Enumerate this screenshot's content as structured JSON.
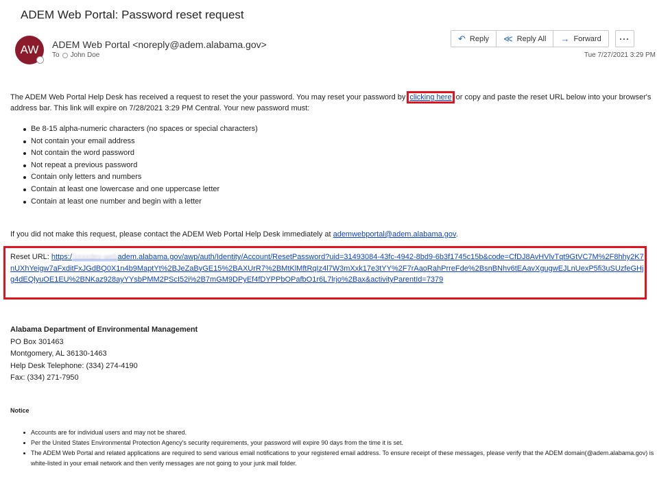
{
  "email": {
    "subject": "ADEM Web Portal: Password reset request",
    "avatar_initials": "AW",
    "sender": "ADEM Web Portal <noreply@adem.alabama.gov>",
    "to_label": "To",
    "recipient": "John Doe",
    "timestamp": "Tue 7/27/2021 3:29 PM"
  },
  "toolbar": {
    "reply_label": "Reply",
    "reply_all_label": "Reply All",
    "forward_label": "Forward",
    "more_label": "···",
    "reply_icon": "reply-arrow-icon",
    "reply_all_icon": "reply-all-arrow-icon",
    "forward_icon": "forward-arrow-icon"
  },
  "body": {
    "intro_before": "The ADEM Web Portal Help Desk has received a request to reset the your password. You may reset your password by ",
    "link_text": "clicking here",
    "intro_after": " or copy and paste the reset URL below into your browser's address bar. This link will expire on 7/28/2021 3:29 PM Central. Your new password must:",
    "requirements": [
      "Be 8-15 alpha-numeric characters (no spaces or special characters)",
      "Not contain your email address",
      "Not contain the word password",
      "Not repeat a previous password",
      "Contain only letters and numbers",
      "Contain at least one lowercase and one uppercase letter",
      "Contain at least one number and begin with a letter"
    ],
    "contact_text": "If you did not make this request, please contact the ADEM Web Portal Help Desk immediately at ",
    "contact_email": "ademwebportal@adem.alabama.gov",
    "contact_end": ".",
    "reset_label": "Reset URL: ",
    "reset_url_start": "https:/",
    "reset_url_blurred": "/xxxxdev-web",
    "reset_url_rest": "adem.alabama.gov/awp/auth/Identity/Account/ResetPassword?uid=31493084-43fc-4942-8bd9-6b3f1745c15b&code=CfDJ8AvHVlvTqt9GtVC7M%2F8hhy2K7nUXhYeigw7aFxditFxJGdBQ0X1n4b9MaptYt%2BJeZaByGE15%2BAXUrR7%2BMtKlMftRqIz4l7W3mXxk17e3tYY%2F7rAaoRahPrreFde%2BsnBNhv6tEAavXgugwEJLnUexP5fi3uSUzfeGHjg4dEQlyuOE1EU%2BNKaz928ayYYsbPMM2PScI52i%2B7mGM9DPyEf4fDYPPbOPafbO1r6L7lrjo%2Bax&activityParentId=7379"
  },
  "organization": {
    "name": "Alabama Department of Environmental Management",
    "po_box": "PO Box 301463",
    "city": "Montgomery, AL 36130-1463",
    "phone": "Help Desk Telephone: (334) 274-4190",
    "fax": "Fax: (334) 271-7950"
  },
  "notice": {
    "title": "Notice",
    "items": [
      "Accounts are for individual users and may not be shared.",
      "Per the United States Environmental Protection Agency's security requirements, your password will expire 90 days from the time it is set.",
      "The ADEM Web Portal and related applications are required to send various email notifications to your registered email address. To ensure receipt of these messages, please verify that the ADEM domain(@adem.alabama.gov) is white-listed in your email network and then verify messages are not going to your junk mail folder."
    ]
  },
  "colors": {
    "avatar_bg": "#8a1a2c",
    "link": "#0b41c8",
    "highlight_border": "#e0141e",
    "icon_accent": "#2b6cb0"
  }
}
